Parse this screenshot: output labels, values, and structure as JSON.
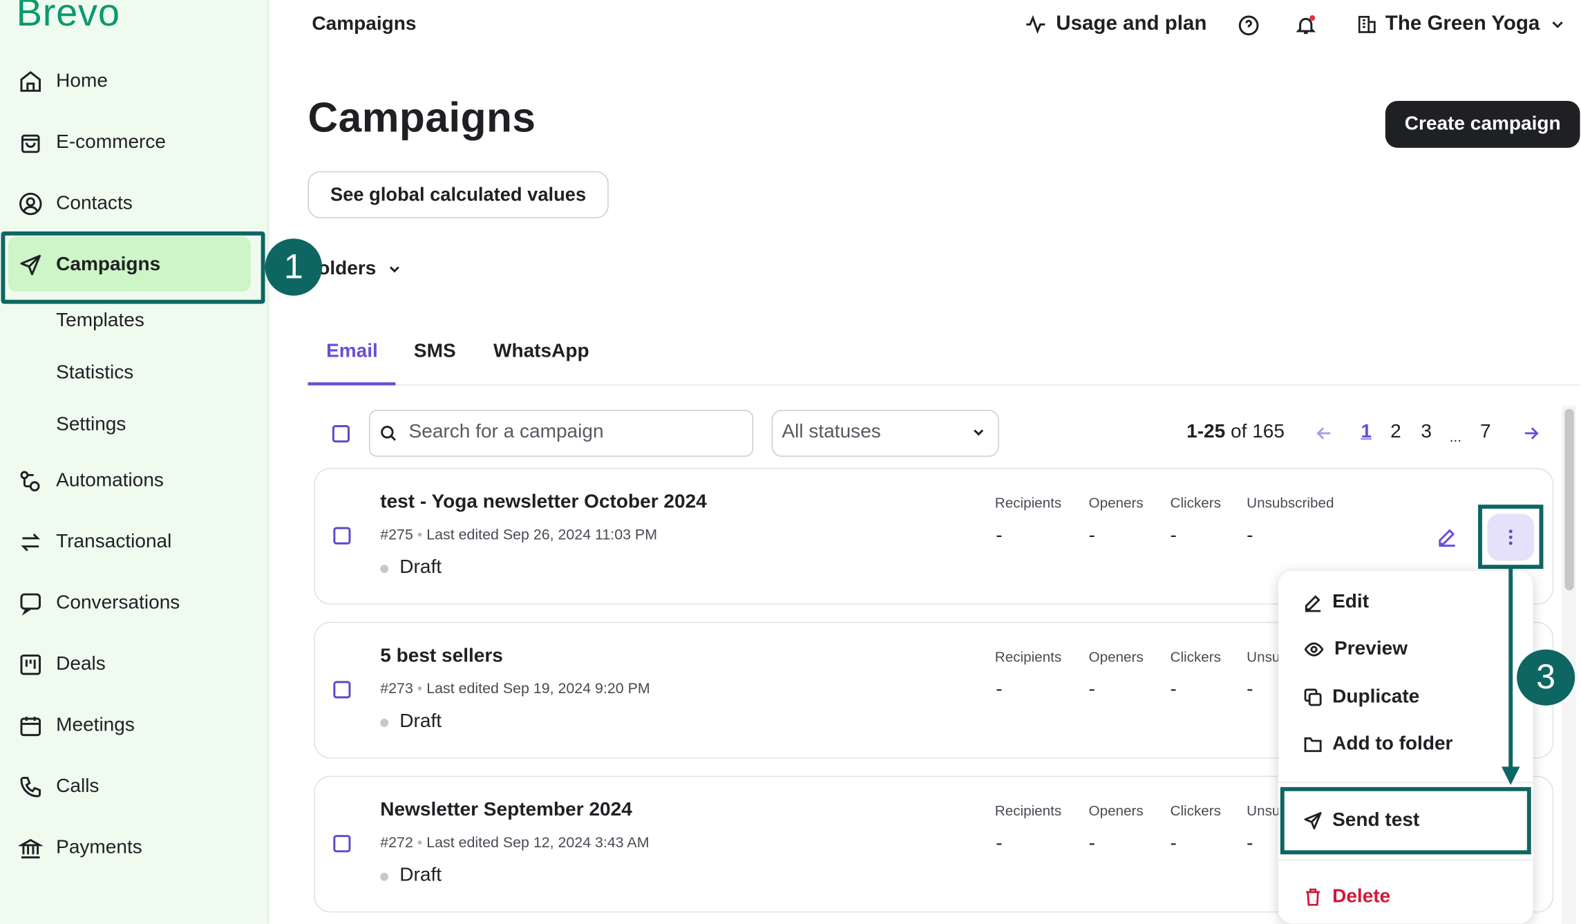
{
  "app": {
    "logo": "Brevo"
  },
  "sidebar": {
    "items": [
      {
        "label": "Home",
        "icon": "home-icon"
      },
      {
        "label": "E-commerce",
        "icon": "shopping-bag-icon"
      },
      {
        "label": "Contacts",
        "icon": "contacts-icon"
      },
      {
        "label": "Campaigns",
        "icon": "paper-plane-icon",
        "active": true
      },
      {
        "label": "Templates"
      },
      {
        "label": "Statistics"
      },
      {
        "label": "Settings"
      },
      {
        "label": "Automations",
        "icon": "automation-icon"
      },
      {
        "label": "Transactional",
        "icon": "transfer-arrows-icon"
      },
      {
        "label": "Conversations",
        "icon": "chat-icon"
      },
      {
        "label": "Deals",
        "icon": "kanban-icon"
      },
      {
        "label": "Meetings",
        "icon": "calendar-icon"
      },
      {
        "label": "Calls",
        "icon": "phone-icon"
      },
      {
        "label": "Payments",
        "icon": "bank-icon"
      }
    ]
  },
  "header": {
    "title": "Campaigns",
    "usage": "Usage and plan",
    "org": "The Green Yoga"
  },
  "page": {
    "title": "Campaigns",
    "create_button": "Create campaign",
    "global_button": "See global calculated values",
    "folders_label": "olders"
  },
  "tabs": [
    {
      "label": "Email",
      "active": true
    },
    {
      "label": "SMS"
    },
    {
      "label": "WhatsApp"
    }
  ],
  "filters": {
    "search_placeholder": "Search for a campaign",
    "status_value": "All statuses"
  },
  "pagination": {
    "range_bold": "1-25",
    "range_rest": "of 165",
    "pages": [
      "1",
      "2",
      "3",
      "...",
      "7"
    ],
    "current": "1"
  },
  "columns": [
    "Recipients",
    "Openers",
    "Clickers",
    "Unsubscribed"
  ],
  "columns_truncated": "Unsu",
  "campaigns": [
    {
      "title": "test - Yoga newsletter October 2024",
      "id": "#275",
      "edited": "Last edited Sep 26, 2024 11:03 PM",
      "status": "Draft",
      "values": [
        "-",
        "-",
        "-",
        "-"
      ]
    },
    {
      "title": "5 best sellers",
      "id": "#273",
      "edited": "Last edited Sep 19, 2024 9:20 PM",
      "status": "Draft",
      "values": [
        "-",
        "-",
        "-",
        "-"
      ]
    },
    {
      "title": "Newsletter September 2024",
      "id": "#272",
      "edited": "Last edited Sep 12, 2024 3:43 AM",
      "status": "Draft",
      "values": [
        "-",
        "-",
        "-",
        "-"
      ]
    }
  ],
  "meta_separator": "•",
  "menu": {
    "items": [
      {
        "label": "Edit",
        "icon": "pencil-icon"
      },
      {
        "label": "Preview",
        "icon": "eye-icon"
      },
      {
        "label": "Duplicate",
        "icon": "duplicate-icon"
      },
      {
        "label": "Add to folder",
        "icon": "folder-icon"
      },
      {
        "label": "Send test",
        "icon": "paper-plane-icon"
      },
      {
        "label": "Delete",
        "icon": "trash-icon"
      }
    ]
  },
  "steps": {
    "one": "1",
    "three": "3"
  },
  "colors": {
    "brand": "#0b996e",
    "accent": "#6c4cd9",
    "annotation": "#0e6663",
    "delete": "#d1193a",
    "active_nav": "#cdf5c7",
    "sidebar_bg": "#effbef"
  }
}
